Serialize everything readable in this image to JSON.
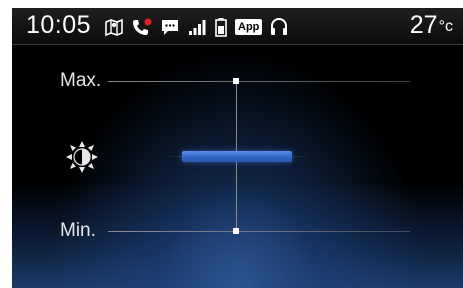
{
  "status_bar": {
    "time": "10:05",
    "icons": [
      "map-book-icon",
      "phone-missed-call-icon",
      "message-icon",
      "signal-strength-icon",
      "battery-icon",
      "app-icon",
      "headset-icon"
    ],
    "app_badge": "App",
    "temperature": "27",
    "temperature_unit": "°c"
  },
  "brightness": {
    "max_label": "Max.",
    "min_label": "Min.",
    "icon": "brightness-icon",
    "level": 0.5,
    "accent_color": "#3a6fd8"
  }
}
